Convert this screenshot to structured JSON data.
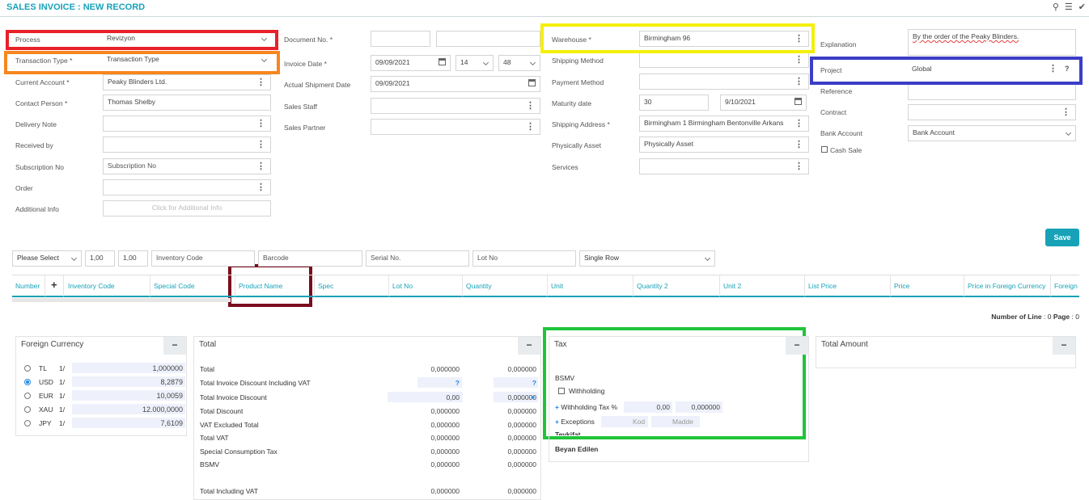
{
  "header": {
    "title": "SALES INVOICE : NEW RECORD"
  },
  "form_left": {
    "process_label": "Process",
    "process_value": "Revizyon",
    "transaction_type_label": "Transaction Type *",
    "transaction_type_value": "Transaction Type",
    "current_account_label": "Current Account *",
    "current_account_value": "Peaky Blinders Ltd.",
    "contact_person_label": "Contact Person *",
    "contact_person_value": "Thomas Shelby",
    "delivery_note_label": "Delivery Note",
    "received_by_label": "Received by",
    "subscription_no_label": "Subscription No",
    "subscription_no_placeholder": "Subscription No",
    "order_label": "Order",
    "additional_info_label": "Additional Info",
    "additional_info_placeholder": "Click for Additional Info"
  },
  "form_mid": {
    "document_no_label": "Document No. *",
    "invoice_date_label": "Invoice Date *",
    "invoice_date_value": "09/09/2021",
    "invoice_hour": "14",
    "invoice_minute": "48",
    "actual_shipment_date_label": "Actual Shipment Date",
    "actual_shipment_date_value": "09/09/2021",
    "sales_staff_label": "Sales Staff",
    "sales_partner_label": "Sales Partner"
  },
  "form_right": {
    "warehouse_label": "Warehouse *",
    "warehouse_value": "Birmingham 96",
    "shipping_method_label": "Shipping Method",
    "payment_method_label": "Payment Method",
    "maturity_date_label": "Maturity date",
    "maturity_days": "30",
    "maturity_date_value": "9/10/2021",
    "shipping_address_label": "Shipping Address *",
    "shipping_address_value": "Birmingham 1 Birmingham Bentonville Arkans",
    "physically_asset_label": "Physically Asset",
    "physically_asset_value": "Physically Asset",
    "services_label": "Services"
  },
  "form_far": {
    "explanation_label": "Explanation",
    "explanation_value": "By the order of the Peaky Blinders.",
    "project_label": "Project",
    "project_value": "Global",
    "reference_label": "Reference",
    "contract_label": "Contract",
    "bank_account_label": "Bank Account",
    "bank_account_value": "Bank Account",
    "cash_sale_label": "Cash Sale"
  },
  "toolbar": {
    "save_label": "Save",
    "please_select": "Please Select",
    "qty1": "1,00",
    "qty2": "1,00",
    "inventory_code_placeholder": "Inventory Code",
    "barcode_placeholder": "Barcode",
    "serial_no_placeholder": "Serial No.",
    "lot_no_placeholder": "Lot No",
    "row_mode": "Single Row"
  },
  "table": {
    "columns": [
      "Number",
      "+",
      "Inventory Code",
      "Special Code",
      "Product Name",
      "Spec",
      "Lot No",
      "Quantity",
      "Unit",
      "Quantity 2",
      "Unit 2",
      "List Price",
      "Price",
      "Price in Foreign Currency",
      "Foreign"
    ],
    "footer_label": "Number of Line",
    "footer_value": ": 0",
    "page_label": "Page",
    "page_value": ": 0"
  },
  "foreign_currency": {
    "title": "Foreign Currency",
    "rows": [
      {
        "code": "TL",
        "ratio": "1/",
        "value": "1,000000",
        "selected": false
      },
      {
        "code": "USD",
        "ratio": "1/",
        "value": "8,2879",
        "selected": true
      },
      {
        "code": "EUR",
        "ratio": "1/",
        "value": "10,0059",
        "selected": false
      },
      {
        "code": "XAU",
        "ratio": "1/",
        "value": "12.000,0000",
        "selected": false
      },
      {
        "code": "JPY",
        "ratio": "1/",
        "value": "7,6109",
        "selected": false
      }
    ]
  },
  "totals": {
    "title": "Total",
    "rows": [
      {
        "label": "Total",
        "v1": "0,000000",
        "v2": "0,000000"
      },
      {
        "label": "Total Invoice Discount Including VAT",
        "v1": "?",
        "v2": "?"
      },
      {
        "label": "Total Invoice Discount",
        "v1": "0,00",
        "v2": "0,000000"
      },
      {
        "label": "Total Discount",
        "v1": "0,000000",
        "v2": "0,000000"
      },
      {
        "label": "VAT Excluded Total",
        "v1": "0,000000",
        "v2": "0,000000"
      },
      {
        "label": "Total VAT",
        "v1": "0,000000",
        "v2": "0,000000"
      },
      {
        "label": "Special Consumption Tax",
        "v1": "0,000000",
        "v2": "0,000000"
      },
      {
        "label": "BSMV",
        "v1": "0,000000",
        "v2": "0,000000"
      },
      {
        "label": "Total Including VAT",
        "v1": "0,000000",
        "v2": "0,000000"
      }
    ]
  },
  "tax": {
    "title": "Tax",
    "bsmv_label": "BSMV",
    "withholding_label": "Withholding",
    "withholding_tax_label": "Withholding Tax %",
    "withholding_rate": "0,00",
    "withholding_amount": "0,000000",
    "exceptions_label": "Exceptions",
    "kod_placeholder": "Kod",
    "madde_placeholder": "Madde",
    "tevkifat_label": "Tevkifat",
    "beyan_label": "Beyan Edilen"
  },
  "total_amount": {
    "title": "Total Amount"
  },
  "colors": {
    "accent": "#17a2b8",
    "red": "#e8202a",
    "orange": "#f7861e",
    "yellow": "#f5ef0b",
    "blue": "#3b3dc8",
    "maroon": "#7a0c1d",
    "green": "#1fc43a"
  }
}
